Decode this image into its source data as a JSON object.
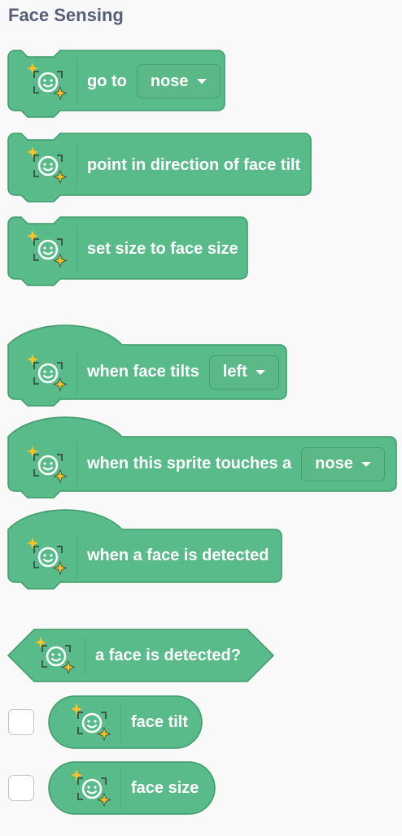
{
  "category": {
    "title": "Face Sensing"
  },
  "colors": {
    "block_fill": "#59bb8a",
    "block_stroke": "#3f9b6b",
    "icon_star": "#ffc21e"
  },
  "blocks": [
    {
      "kind": "command",
      "label": "go to",
      "dropdown": "nose"
    },
    {
      "kind": "command",
      "label": "point in direction of face tilt"
    },
    {
      "kind": "command",
      "label": "set size to face size"
    },
    {
      "kind": "hat",
      "label": "when face tilts",
      "dropdown": "left"
    },
    {
      "kind": "hat",
      "label": "when this sprite touches a",
      "dropdown": "nose"
    },
    {
      "kind": "hat",
      "label": "when a face is detected"
    },
    {
      "kind": "boolean",
      "label": "a face is detected?"
    },
    {
      "kind": "reporter",
      "label": "face tilt",
      "checkbox_checked": false
    },
    {
      "kind": "reporter",
      "label": "face size",
      "checkbox_checked": false
    }
  ]
}
